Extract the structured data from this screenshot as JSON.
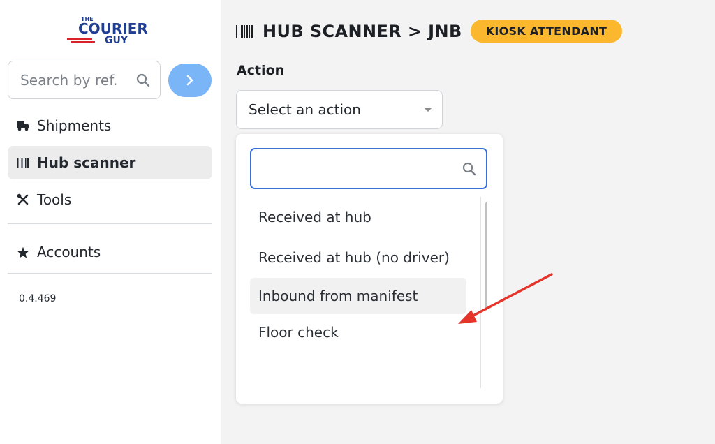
{
  "logo": {
    "line1": "THE",
    "line2": "COURIER",
    "line3": "GUY"
  },
  "sidebar": {
    "search_placeholder": "Search by ref.",
    "items": [
      {
        "label": "Shipments",
        "icon": "truck-icon"
      },
      {
        "label": "Hub scanner",
        "icon": "barcode-icon",
        "active": true
      },
      {
        "label": "Tools",
        "icon": "tools-icon"
      },
      {
        "label": "Accounts",
        "icon": "star-icon"
      }
    ],
    "version": "0.4.469"
  },
  "header": {
    "title": "HUB SCANNER > JNB",
    "badge": "KIOSK ATTENDANT"
  },
  "action": {
    "label": "Action",
    "select_value": "Select an action",
    "search_value": "",
    "options": [
      "Received at hub",
      "Received at hub (no driver)",
      "Inbound from manifest",
      "Floor check"
    ],
    "highlighted": "Inbound from manifest"
  },
  "colors": {
    "accent_blue": "#7ab6f7",
    "badge": "#fbb82f",
    "focus": "#3a6fd8",
    "annotation_arrow": "#e5342a",
    "logo_blue": "#1f3e94",
    "logo_red": "#d8232a"
  }
}
